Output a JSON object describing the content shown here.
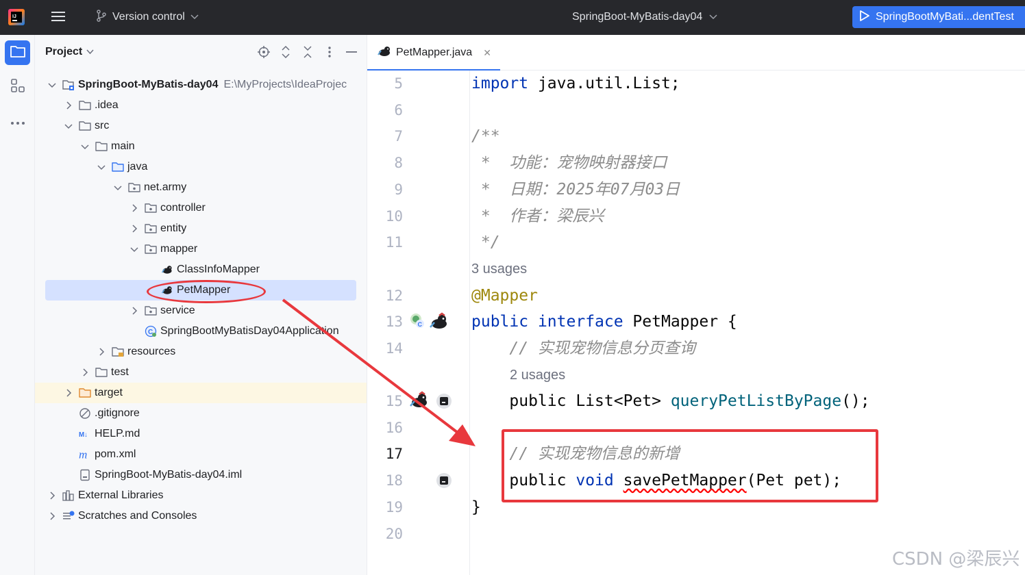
{
  "titlebar": {
    "version_control": "Version control",
    "project_name": "SpringBoot-MyBatis-day04",
    "run_config": "SpringBootMyBati...dentTest"
  },
  "project_panel": {
    "title": "Project",
    "tree": [
      {
        "label": "SpringBoot-MyBatis-day04",
        "path": "E:\\MyProjects\\IdeaProjec",
        "depth": 0,
        "icon": "module-icon",
        "expanded": true,
        "bold": true
      },
      {
        "label": ".idea",
        "depth": 1,
        "icon": "folder-icon",
        "expanded": false
      },
      {
        "label": "src",
        "depth": 1,
        "icon": "folder-icon",
        "expanded": true
      },
      {
        "label": "main",
        "depth": 2,
        "icon": "folder-icon",
        "expanded": true
      },
      {
        "label": "java",
        "depth": 3,
        "icon": "source-folder-icon",
        "expanded": true
      },
      {
        "label": "net.army",
        "depth": 4,
        "icon": "package-icon",
        "expanded": true
      },
      {
        "label": "controller",
        "depth": 5,
        "icon": "package-icon",
        "expanded": false
      },
      {
        "label": "entity",
        "depth": 5,
        "icon": "package-icon",
        "expanded": false
      },
      {
        "label": "mapper",
        "depth": 5,
        "icon": "package-icon",
        "expanded": true
      },
      {
        "label": "ClassInfoMapper",
        "depth": 6,
        "icon": "mybatis-icon"
      },
      {
        "label": "PetMapper",
        "depth": 6,
        "icon": "mybatis-icon",
        "selected": true
      },
      {
        "label": "service",
        "depth": 5,
        "icon": "package-icon",
        "expanded": false
      },
      {
        "label": "SpringBootMyBatisDay04Application",
        "depth": 5,
        "icon": "spring-class-icon"
      },
      {
        "label": "resources",
        "depth": 3,
        "icon": "resources-folder-icon",
        "expanded": false
      },
      {
        "label": "test",
        "depth": 2,
        "icon": "folder-icon",
        "expanded": false
      },
      {
        "label": "target",
        "depth": 1,
        "icon": "excluded-folder-icon",
        "expanded": false,
        "highlight": true
      },
      {
        "label": ".gitignore",
        "depth": 1,
        "icon": "gitignore-icon"
      },
      {
        "label": "HELP.md",
        "depth": 1,
        "icon": "markdown-icon"
      },
      {
        "label": "pom.xml",
        "depth": 1,
        "icon": "maven-icon"
      },
      {
        "label": "SpringBoot-MyBatis-day04.iml",
        "depth": 1,
        "icon": "iml-file-icon"
      },
      {
        "label": "External Libraries",
        "depth": 0,
        "icon": "libraries-icon",
        "expanded": false
      },
      {
        "label": "Scratches and Consoles",
        "depth": 0,
        "icon": "scratches-icon",
        "expanded": false
      }
    ]
  },
  "editor": {
    "tab_label": "PetMapper.java",
    "current_line": "17",
    "lines": [
      {
        "n": "5"
      },
      {
        "n": "6"
      },
      {
        "n": "7"
      },
      {
        "n": "8"
      },
      {
        "n": "9"
      },
      {
        "n": "10"
      },
      {
        "n": "11"
      },
      {
        "n": "12"
      },
      {
        "n": "13"
      },
      {
        "n": "14"
      },
      {
        "n": "15"
      },
      {
        "n": "16"
      },
      {
        "n": "17"
      },
      {
        "n": "18"
      },
      {
        "n": "19"
      },
      {
        "n": "20"
      }
    ],
    "code": {
      "l5_kw": "import",
      "l5_rest": " java.util.List;",
      "l7": "/**",
      "l8": " *  功能：宠物映射器接口",
      "l9": " *  日期：2025年07月03日",
      "l10": " *  作者：梁辰兴",
      "l11": " */",
      "usages_1": "3 usages",
      "l12": "@Mapper",
      "l13_kw1": "public",
      "l13_kw2": "interface",
      "l13_rest": " PetMapper {",
      "l14": "    // 实现宠物信息分页查询",
      "usages_2": "2 usages",
      "l15_kw": "    public",
      "l15_type": " List<Pet> ",
      "l15_fn": "queryPetListByPage",
      "l15_end": "();",
      "l17": "    // 实现宠物信息的新增",
      "l18_kw1": "    public",
      "l18_kw2": "void",
      "l18_fn": "savePetMapper",
      "l18_end": "(Pet pet);",
      "l19": "}"
    }
  },
  "watermark": "CSDN @梁辰兴",
  "colors": {
    "accent": "#3574f0",
    "annotation_red": "#e8383d",
    "selection": "#d5e1ff"
  }
}
